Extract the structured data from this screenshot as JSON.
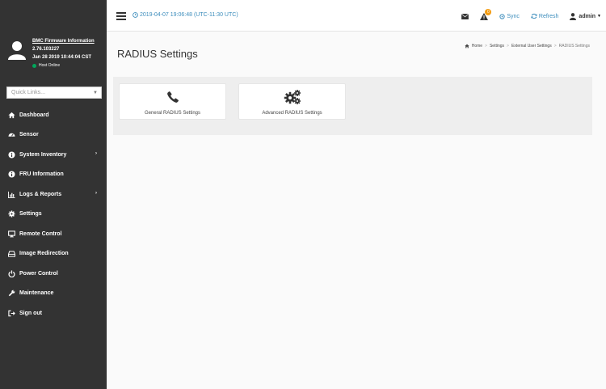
{
  "sidebar": {
    "firmware_title": "BMC Firmware Information",
    "firmware_version": "2.76.103227",
    "build_date": "Jan 28 2019 10:44:04 CST",
    "host_status": "Host Online",
    "host_status_color": "#00a65a",
    "quick_links_placeholder": "Quick Links...",
    "menu": [
      {
        "label": "Dashboard",
        "icon": "home-icon"
      },
      {
        "label": "Sensor",
        "icon": "tachometer-icon"
      },
      {
        "label": "System Inventory",
        "icon": "info-circle-icon",
        "has_submenu": true
      },
      {
        "label": "FRU Information",
        "icon": "info-circle-icon"
      },
      {
        "label": "Logs & Reports",
        "icon": "bar-chart-icon",
        "has_submenu": true
      },
      {
        "label": "Settings",
        "icon": "gear-icon"
      },
      {
        "label": "Remote Control",
        "icon": "desktop-icon"
      },
      {
        "label": "Image Redirection",
        "icon": "hdd-icon"
      },
      {
        "label": "Power Control",
        "icon": "power-icon"
      },
      {
        "label": "Maintenance",
        "icon": "wrench-icon"
      },
      {
        "label": "Sign out",
        "icon": "sign-out-icon"
      }
    ]
  },
  "topbar": {
    "datetime": "2019-04-07 19:06:48 (UTC-11:30 UTC)",
    "alert_count": "0",
    "sync_label": "Sync",
    "refresh_label": "Refresh",
    "user_label": "admin",
    "accent_color": "#3c8dbc"
  },
  "page": {
    "title": "RADIUS Settings",
    "breadcrumb": [
      "Home",
      "Settings",
      "External User Settings",
      "RADIUS Settings"
    ],
    "tiles": [
      {
        "label": "General RADIUS Settings",
        "icon": "phone-icon"
      },
      {
        "label": "Advanced RADIUS Settings",
        "icon": "gears-icon"
      }
    ]
  }
}
